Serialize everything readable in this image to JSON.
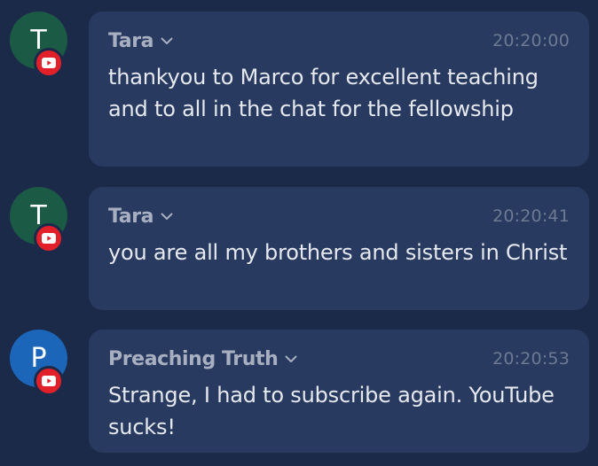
{
  "colors": {
    "background": "#1c2a4a",
    "bubble": "#283a5f",
    "avatar_tara": "#1b5a44",
    "avatar_preaching": "#1c66b9",
    "youtube_red": "#e2202a"
  },
  "messages": [
    {
      "avatar_letter": "T",
      "author": "Tara",
      "time": "20:20:00",
      "text": "thankyou to Marco for excellent teaching and to all in the chat for the fellowship",
      "platform_icon": "youtube-icon"
    },
    {
      "avatar_letter": "T",
      "author": "Tara",
      "time": "20:20:41",
      "text": "you are all my brothers and sisters in Christ",
      "platform_icon": "youtube-icon"
    },
    {
      "avatar_letter": "P",
      "author": "Preaching Truth",
      "time": "20:20:53",
      "text": "Strange, I had to subscribe again. YouTube sucks!",
      "platform_icon": "youtube-icon"
    }
  ]
}
